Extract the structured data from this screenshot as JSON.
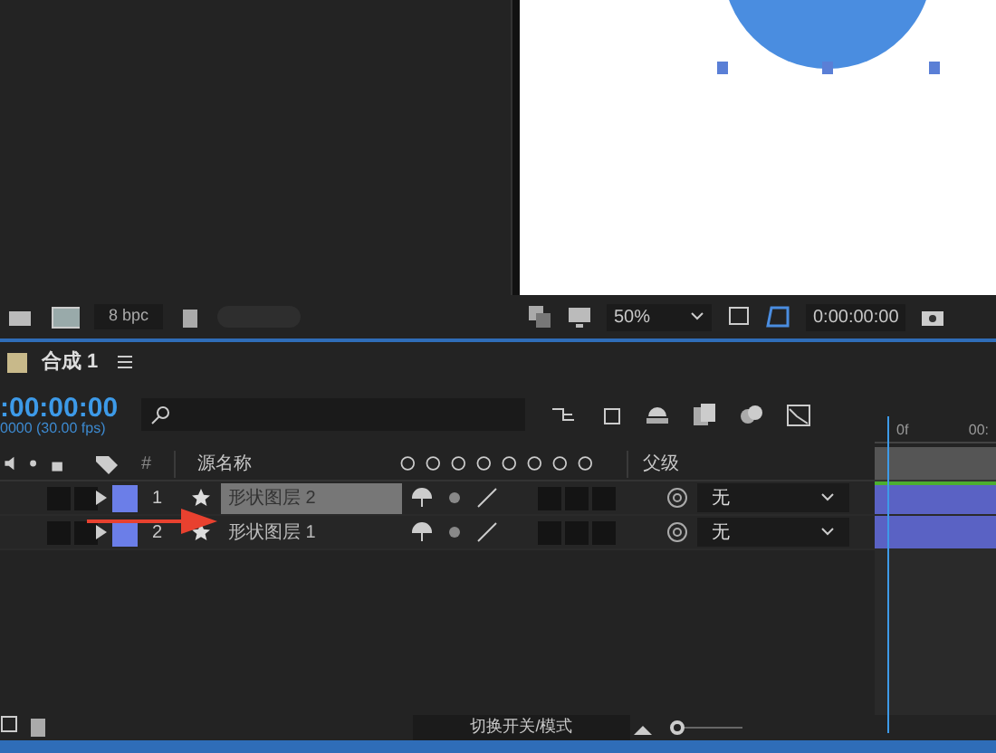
{
  "viewer": {
    "bit_depth": "8 bpc",
    "zoom": "50%",
    "timecode": "0:00:00:00"
  },
  "composition": {
    "tab": "合成 1",
    "timecode": ":00:00:00",
    "fps": "0000 (30.00 fps)"
  },
  "ruler": [
    "0f",
    "00:"
  ],
  "columns": {
    "number": "#",
    "source_name": "源名称",
    "parent": "父级"
  },
  "layers": [
    {
      "number": "1",
      "name": "形状图层 2",
      "selected": true,
      "expanded": false,
      "parent": "无"
    },
    {
      "number": "2",
      "name": "形状图层 1",
      "selected": false,
      "expanded": false,
      "parent": "无"
    }
  ],
  "footer": {
    "toggle": "切换开关/模式",
    "zoom": {
      "level": 0
    }
  }
}
